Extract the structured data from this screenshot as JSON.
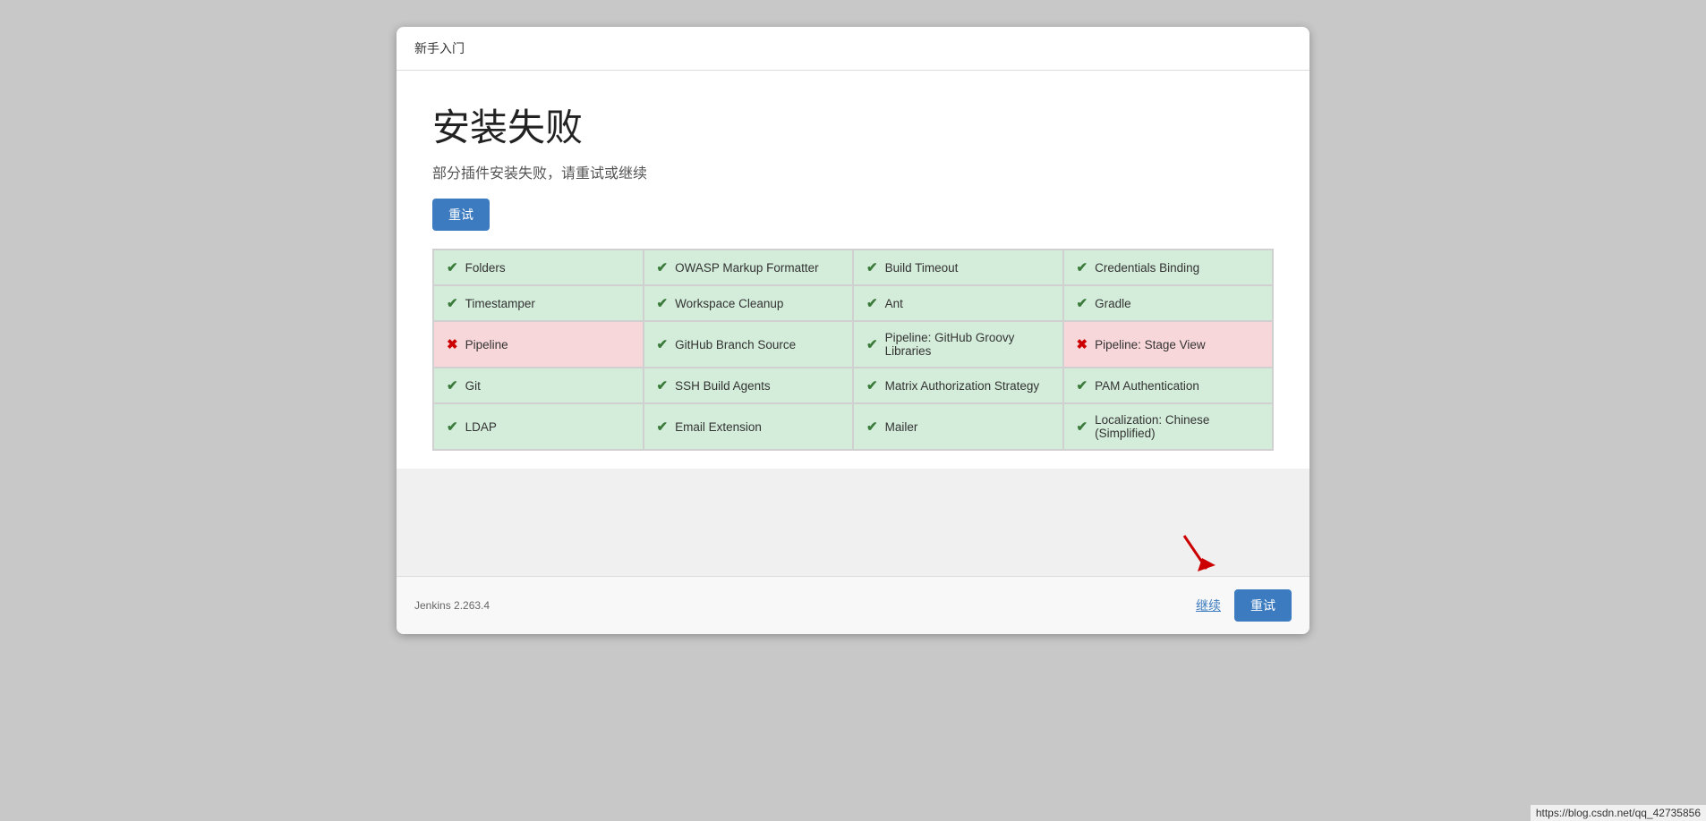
{
  "header": {
    "title": "新手入门"
  },
  "main": {
    "install_title": "安装失败",
    "install_subtitle": "部分插件安装失败，请重试或继续",
    "retry_label": "重试"
  },
  "plugins": [
    {
      "name": "Folders",
      "status": "success"
    },
    {
      "name": "OWASP Markup Formatter",
      "status": "success"
    },
    {
      "name": "Build Timeout",
      "status": "success"
    },
    {
      "name": "Credentials Binding",
      "status": "success"
    },
    {
      "name": "Timestamper",
      "status": "success"
    },
    {
      "name": "Workspace Cleanup",
      "status": "success"
    },
    {
      "name": "Ant",
      "status": "success"
    },
    {
      "name": "Gradle",
      "status": "success"
    },
    {
      "name": "Pipeline",
      "status": "error"
    },
    {
      "name": "GitHub Branch Source",
      "status": "success"
    },
    {
      "name": "Pipeline: GitHub Groovy Libraries",
      "status": "success"
    },
    {
      "name": "Pipeline: Stage View",
      "status": "error"
    },
    {
      "name": "Git",
      "status": "success"
    },
    {
      "name": "SSH Build Agents",
      "status": "success"
    },
    {
      "name": "Matrix Authorization Strategy",
      "status": "success"
    },
    {
      "name": "PAM Authentication",
      "status": "success"
    },
    {
      "name": "LDAP",
      "status": "success"
    },
    {
      "name": "Email Extension",
      "status": "success"
    },
    {
      "name": "Mailer",
      "status": "success"
    },
    {
      "name": "Localization: Chinese (Simplified)",
      "status": "success"
    }
  ],
  "footer": {
    "version": "Jenkins 2.263.4",
    "continue_label": "继续",
    "retry_label": "重试"
  },
  "url_bar": "https://blog.csdn.net/qq_42735856"
}
